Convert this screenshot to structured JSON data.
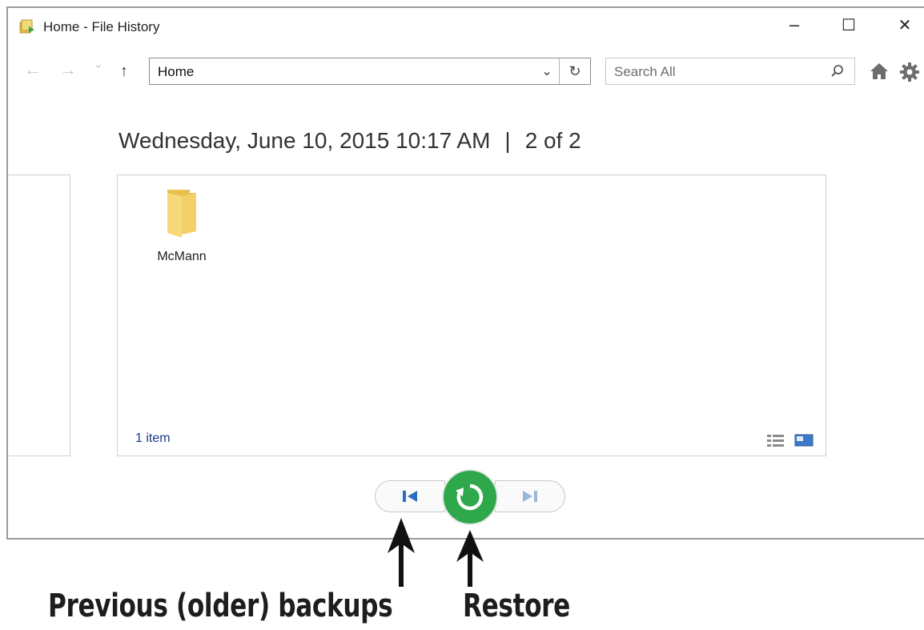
{
  "window": {
    "title": "Home - File History",
    "minimize_label": "–",
    "maximize_label": "☐",
    "close_label": "✕"
  },
  "toolbar": {
    "back_label": "←",
    "forward_label": "→",
    "recent_label": "⌄",
    "up_label": "↑",
    "address_value": "Home",
    "address_dropdown_label": "⌄",
    "refresh_label": "↻",
    "search_placeholder": "Search All"
  },
  "snapshot": {
    "date": "Wednesday, June 10, 2015 10:17 AM",
    "separator": "|",
    "position": "2 of 2"
  },
  "content": {
    "items": [
      {
        "name": "McMann",
        "icon": "folder-icon"
      }
    ],
    "status": "1 item"
  },
  "controls": {
    "previous": "previous-backup-icon",
    "restore": "restore-icon",
    "next": "next-backup-icon",
    "restore_color": "#2ea84b",
    "arrow_color": "#2b6cc4"
  },
  "annotations": {
    "previous_label": "Previous (older) backups",
    "restore_label": "Restore"
  }
}
